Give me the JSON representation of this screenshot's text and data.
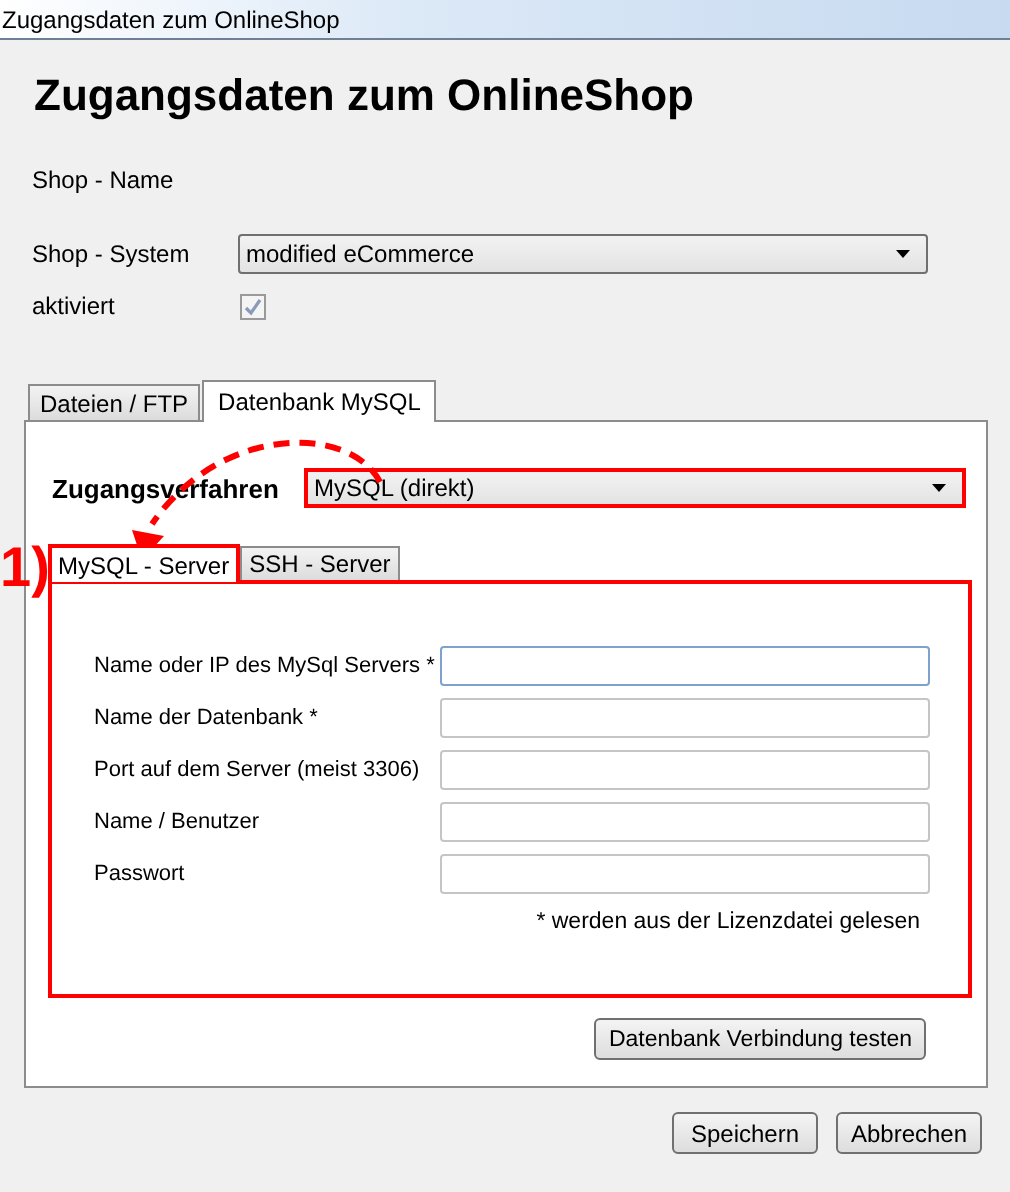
{
  "window": {
    "title": "Zugangsdaten zum OnlineShop"
  },
  "heading": "Zugangsdaten zum OnlineShop",
  "shop_name": {
    "label": "Shop - Name"
  },
  "shop_system": {
    "label": "Shop - System",
    "value": "modified eCommerce"
  },
  "activated": {
    "label": "aktiviert",
    "checked": true
  },
  "tabs": [
    {
      "label": "Dateien / FTP",
      "selected": false
    },
    {
      "label": "Datenbank MySQL",
      "selected": true
    }
  ],
  "access_method": {
    "label": "Zugangsverfahren",
    "value": "MySQL (direkt)",
    "highlighted": true
  },
  "callout": "1)",
  "subtabs": [
    {
      "label": "MySQL - Server",
      "selected": true,
      "highlighted": true
    },
    {
      "label": "SSH - Server",
      "selected": false,
      "highlighted": false
    }
  ],
  "server_panel": {
    "highlighted": true
  },
  "server_fields": [
    {
      "label": "Name oder IP des MySql Servers *",
      "focused": true
    },
    {
      "label": "Name der Datenbank *",
      "focused": false
    },
    {
      "label": "Port auf dem Server (meist 3306)",
      "focused": false
    },
    {
      "label": "Name / Benutzer",
      "focused": false
    },
    {
      "label": "Passwort",
      "focused": false
    }
  ],
  "note": "* werden aus der Lizenzdatei gelesen",
  "test_button": "Datenbank Verbindung testen",
  "buttons": [
    "Speichern",
    "Abbrechen"
  ]
}
